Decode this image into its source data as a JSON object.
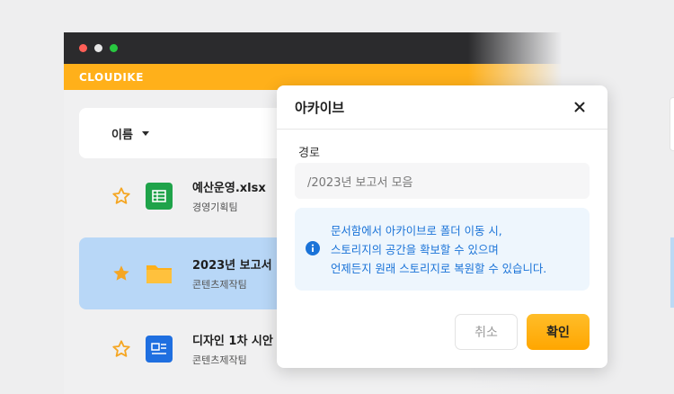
{
  "window": {
    "brand": "CLOUDIKE",
    "traffic_colors": [
      "#ff5f57",
      "#e6e6e6",
      "#28c840"
    ]
  },
  "list": {
    "sort_label": "이름",
    "files": [
      {
        "name": "예산운영.xlsx",
        "owner": "경영기획팀",
        "icon": "spreadsheet-icon",
        "starred": false,
        "selected": false
      },
      {
        "name": "2023년 보고서",
        "owner": "콘텐츠제작팀",
        "icon": "folder-icon",
        "starred": true,
        "selected": true
      },
      {
        "name": "디자인 1차 시안",
        "owner": "콘텐츠제작팀",
        "icon": "presentation-icon",
        "starred": false,
        "selected": false
      }
    ]
  },
  "dialog": {
    "title": "아카이브",
    "path_label": "경로",
    "path_value": "/2023년 보고서 모음",
    "info_lines": [
      "문서함에서 아카이브로 폴더 이동 시,",
      "스토리지의 공간을 확보할 수 있으며",
      "언제든지 원래 스토리지로 복원할 수 있습니다."
    ],
    "cancel_label": "취소",
    "confirm_label": "확인"
  },
  "colors": {
    "accent": "#ffb01a",
    "selected_row": "#b8d7f7",
    "info_text": "#1a73d8",
    "star": "#f5a623"
  }
}
